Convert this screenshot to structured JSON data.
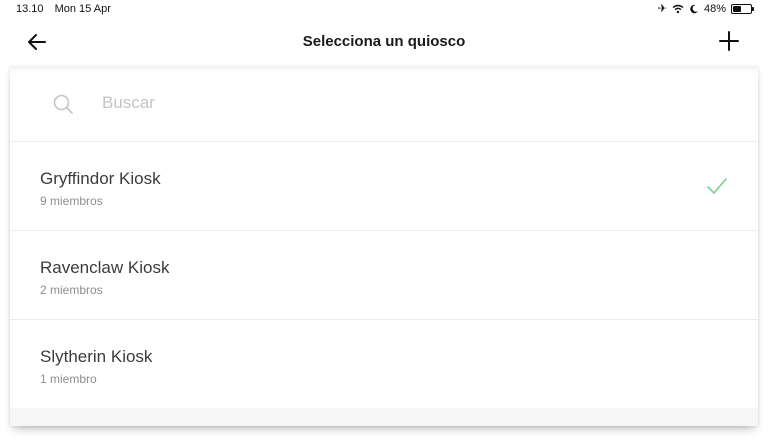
{
  "status_bar": {
    "time": "13.10",
    "date": "Mon 15 Apr",
    "battery_percent": "48%",
    "battery_level": 0.48,
    "icons": [
      "airplane-icon",
      "wifi-icon",
      "moon-icon",
      "battery-icon"
    ]
  },
  "nav": {
    "title": "Selecciona un quiosco",
    "back_icon": "arrow-left-icon",
    "add_icon": "plus-icon"
  },
  "search": {
    "placeholder": "Buscar",
    "value": ""
  },
  "kiosks": [
    {
      "name": "Gryffindor Kiosk",
      "members": "9 miembros",
      "selected": true
    },
    {
      "name": "Ravenclaw Kiosk",
      "members": "2 miembros",
      "selected": false
    },
    {
      "name": "Slytherin Kiosk",
      "members": "1 miembro",
      "selected": false
    }
  ],
  "colors": {
    "check": "#7ed08a",
    "title_text": "#1a1a1a",
    "placeholder": "#c4c4c4",
    "subtext": "#8f8f8f"
  }
}
